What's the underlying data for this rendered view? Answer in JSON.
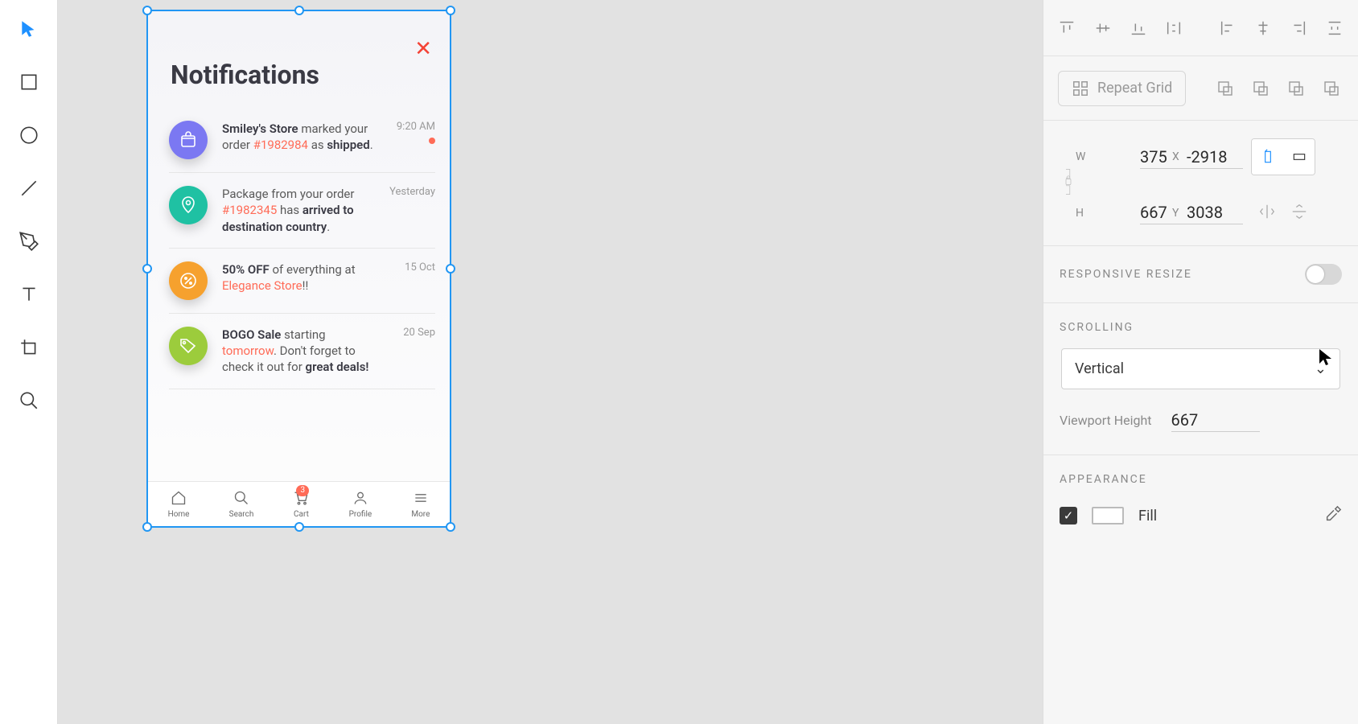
{
  "artboard": {
    "title": "Notifications",
    "close_glyph": "✕",
    "notifications": [
      {
        "icon": "box",
        "color": "indigo",
        "time": "9:20 AM",
        "unread": true,
        "segments": [
          {
            "t": "Smiley's Store",
            "c": "bold"
          },
          {
            "t": " marked your order "
          },
          {
            "t": "#1982984",
            "c": "red"
          },
          {
            "t": " as "
          },
          {
            "t": "shipped",
            "c": "bold"
          },
          {
            "t": "."
          }
        ]
      },
      {
        "icon": "pin",
        "color": "teal",
        "time": "Yesterday",
        "unread": false,
        "segments": [
          {
            "t": "Package from your order "
          },
          {
            "t": "#1982345",
            "c": "red"
          },
          {
            "t": " has "
          },
          {
            "t": "arrived to destination country",
            "c": "bold"
          },
          {
            "t": "."
          }
        ]
      },
      {
        "icon": "percent",
        "color": "orange",
        "time": "15 Oct",
        "unread": false,
        "segments": [
          {
            "t": "50% OFF",
            "c": "bold"
          },
          {
            "t": " of everything at "
          },
          {
            "t": "Elegance Store",
            "c": "red"
          },
          {
            "t": "!!"
          }
        ]
      },
      {
        "icon": "tag",
        "color": "green",
        "time": "20 Sep",
        "unread": false,
        "segments": [
          {
            "t": "BOGO Sale",
            "c": "bold"
          },
          {
            "t": " starting "
          },
          {
            "t": "tomorrow",
            "c": "red"
          },
          {
            "t": ". Don't forget to check it out for "
          },
          {
            "t": "great deals!",
            "c": "bold"
          }
        ]
      }
    ],
    "tabs": [
      {
        "label": "Home",
        "icon": "home",
        "badge": null
      },
      {
        "label": "Search",
        "icon": "search",
        "badge": null
      },
      {
        "label": "Cart",
        "icon": "cart",
        "badge": "3"
      },
      {
        "label": "Profile",
        "icon": "profile",
        "badge": null
      },
      {
        "label": "More",
        "icon": "more",
        "badge": null
      }
    ]
  },
  "inspector": {
    "repeat_label": "Repeat Grid",
    "W_label": "W",
    "W": "375",
    "H_label": "H",
    "H": "667",
    "X_label": "X",
    "X": "-2918",
    "Y_label": "Y",
    "Y": "3038",
    "responsive_title": "RESPONSIVE RESIZE",
    "scrolling_title": "SCROLLING",
    "scroll_mode": "Vertical",
    "vh_label": "Viewport Height",
    "vh_value": "667",
    "appearance_title": "APPEARANCE",
    "fill_label": "Fill"
  }
}
